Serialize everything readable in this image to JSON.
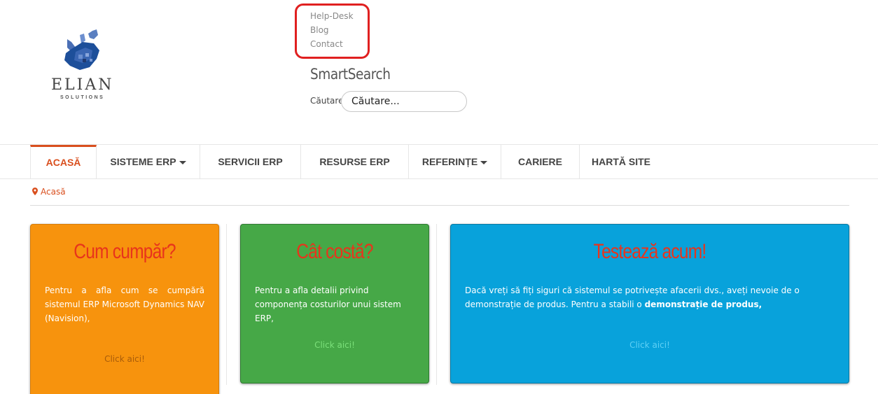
{
  "logo": {
    "name": "ELIAN",
    "tagline": "SOLUTIONS"
  },
  "top_links": [
    "Help-Desk",
    "Blog",
    "Contact"
  ],
  "search": {
    "title": "SmartSearch",
    "label": "Căutare",
    "placeholder": "Căutare..."
  },
  "nav": {
    "items": [
      {
        "label": "ACASĂ"
      },
      {
        "label": "SISTEME ERP"
      },
      {
        "label": "SERVICII ERP"
      },
      {
        "label": "RESURSE ERP"
      },
      {
        "label": "REFERINȚE"
      },
      {
        "label": "CARIERE"
      },
      {
        "label": "HARTĂ SITE"
      }
    ]
  },
  "breadcrumb": {
    "label": "Acasă"
  },
  "cards": [
    {
      "title": "Cum cumpăr?",
      "text": "Pentru a afla  cum se cumpără sistemul ERP Microsoft Dynamics NAV (Navision),",
      "link": "Click aici!",
      "color": "#f7930d"
    },
    {
      "title": "Cât costă?",
      "text": "Pentru a afla detalii privind componența costurilor unui sistem ERP,",
      "link": "Click aici!",
      "color": "#46a847"
    },
    {
      "title": "Testează acum!",
      "text": "Dacă vreți să fiți siguri că sistemul se potrivește afacerii dvs., aveți nevoie de o demonstrație de produs. Pentru a stabili o ",
      "text_bold": "demonstrație de produs,",
      "link": "Click aici!",
      "color": "#08a2db"
    }
  ],
  "colors": {
    "accent": "#d94f1e",
    "title_red": "#e8341c",
    "highlight_box": "#e02020"
  }
}
